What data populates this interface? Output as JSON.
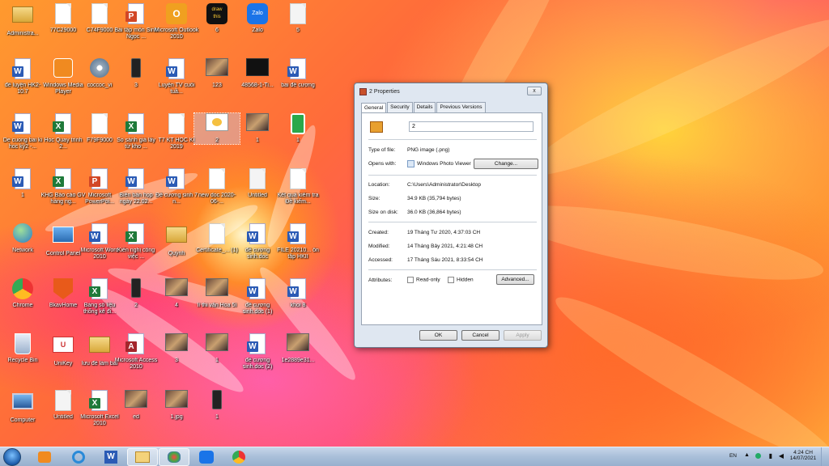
{
  "desktop": {
    "icons": [
      {
        "label": "Administra...",
        "type": "folder"
      },
      {
        "label": "77C29000",
        "type": "doc"
      },
      {
        "label": "C74F9000",
        "type": "doc"
      },
      {
        "label": "Bài tập môn Sinh Ngọc ...",
        "type": "ppt"
      },
      {
        "label": "Microsoft Outlook 2010",
        "type": "outlook"
      },
      {
        "label": "6",
        "type": "drawthis"
      },
      {
        "label": "Zalo",
        "type": "zalo"
      },
      {
        "label": "5",
        "type": "sketch"
      },
      {
        "label": "đề luyện HK2-10.7",
        "type": "word"
      },
      {
        "label": "Windows Media Player",
        "type": "wmp"
      },
      {
        "label": "coccoc_vi",
        "type": "setup"
      },
      {
        "label": "3",
        "type": "phone"
      },
      {
        "label": "Luyện TV cuối tuầ...",
        "type": "word"
      },
      {
        "label": "123",
        "type": "photo"
      },
      {
        "label": "48568-1-Ti...",
        "type": "black"
      },
      {
        "label": "bai đề cương",
        "type": "word"
      },
      {
        "label": "De cuong bai ki hoc kỳ2 -...",
        "type": "word"
      },
      {
        "label": "Hoc Quay trình 2...",
        "type": "excel"
      },
      {
        "label": "F79F9000",
        "type": "doc"
      },
      {
        "label": "So sánh giá lấy từ kho ...",
        "type": "excel"
      },
      {
        "label": "T7 KT HỌC KÌ 2019",
        "type": "doc"
      },
      {
        "label": "2",
        "type": "image"
      },
      {
        "label": "1",
        "type": "photo"
      },
      {
        "label": "1",
        "type": "uno"
      },
      {
        "label": "1",
        "type": "word"
      },
      {
        "label": "KHG Báo cáo GV hàng ng...",
        "type": "excel"
      },
      {
        "label": "Microsoft PowerPoi...",
        "type": "ppt"
      },
      {
        "label": "Biên bản họp ngày 22.02...",
        "type": "word"
      },
      {
        "label": "Đề cương sinh 7 n...",
        "type": "word"
      },
      {
        "label": "new doc 2020-06-...",
        "type": "doc"
      },
      {
        "label": "Untitled",
        "type": "sketch"
      },
      {
        "label": "Kết quả kiểm tra Đề kiểm...",
        "type": "doc"
      },
      {
        "label": "Network",
        "type": "network"
      },
      {
        "label": "Control Panel",
        "type": "control"
      },
      {
        "label": "Microsoft Word 2010",
        "type": "word"
      },
      {
        "label": "Kiến nghị công việc ...",
        "type": "excel"
      },
      {
        "label": "Quỳnh",
        "type": "folder"
      },
      {
        "label": "Certificate_... (1)",
        "type": "doc"
      },
      {
        "label": "đề cương sinh.doc",
        "type": "word"
      },
      {
        "label": "FILE 20210... ôn tập HKII",
        "type": "word"
      },
      {
        "label": "Chrome",
        "type": "chrome"
      },
      {
        "label": "BkavHome",
        "type": "bkav"
      },
      {
        "label": "Bảng số liệu thống kê đi...",
        "type": "excel"
      },
      {
        "label": "2",
        "type": "phone"
      },
      {
        "label": "4",
        "type": "photo"
      },
      {
        "label": "lì thi văn Hoa 5ì",
        "type": "photo"
      },
      {
        "label": "đề cương sinh.doc (1)",
        "type": "word"
      },
      {
        "label": "khoi 8",
        "type": "word"
      },
      {
        "label": "Recycle Bin",
        "type": "recycle"
      },
      {
        "label": "UniKey",
        "type": "unikey"
      },
      {
        "label": "lưu đề làm bài",
        "type": "folder"
      },
      {
        "label": "Microsoft Access 2010",
        "type": "access"
      },
      {
        "label": "3",
        "type": "photo"
      },
      {
        "label": "1",
        "type": "photo"
      },
      {
        "label": "đề cương sinh.doc (2)",
        "type": "word"
      },
      {
        "label": "1e2889e31...",
        "type": "photo"
      },
      {
        "label": "Computer",
        "type": "computer"
      },
      {
        "label": "Untitled",
        "type": "sketch"
      },
      {
        "label": "Microsoft Excel 2010",
        "type": "excel"
      },
      {
        "label": "ed",
        "type": "photo"
      },
      {
        "label": "1.jpg",
        "type": "photo"
      },
      {
        "label": "1",
        "type": "phone"
      }
    ]
  },
  "dialog": {
    "title": "2 Properties",
    "close_label": "x",
    "tabs": [
      "General",
      "Security",
      "Details",
      "Previous Versions"
    ],
    "file_name": "2",
    "type_of_file_label": "Type of file:",
    "type_of_file": "PNG image (.png)",
    "opens_with_label": "Opens with:",
    "opens_with": "Windows Photo Viewer",
    "change_label": "Change...",
    "location_label": "Location:",
    "location": "C:\\Users\\Administrator\\Desktop",
    "size_label": "Size:",
    "size": "34.9 KB (35,794 bytes)",
    "size_on_disk_label": "Size on disk:",
    "size_on_disk": "36.0 KB (36,864 bytes)",
    "created_label": "Created:",
    "created": "19 Tháng Tư 2020, 4:37:03 CH",
    "modified_label": "Modified:",
    "modified": "14 Tháng Bảy 2021, 4:21:48 CH",
    "accessed_label": "Accessed:",
    "accessed": "17 Tháng Sáu 2021, 8:33:54 CH",
    "attributes_label": "Attributes:",
    "readonly_label": "Read-only",
    "hidden_label": "Hidden",
    "advanced_label": "Advanced...",
    "ok_label": "OK",
    "cancel_label": "Cancel",
    "apply_label": "Apply"
  },
  "taskbar": {
    "language": "EN",
    "time": "4:24 CH",
    "date": "14/07/2021"
  },
  "colors": {
    "word": "#2b5bb5",
    "excel": "#1f7a3a",
    "ppt": "#d24726",
    "access": "#a4262c"
  }
}
